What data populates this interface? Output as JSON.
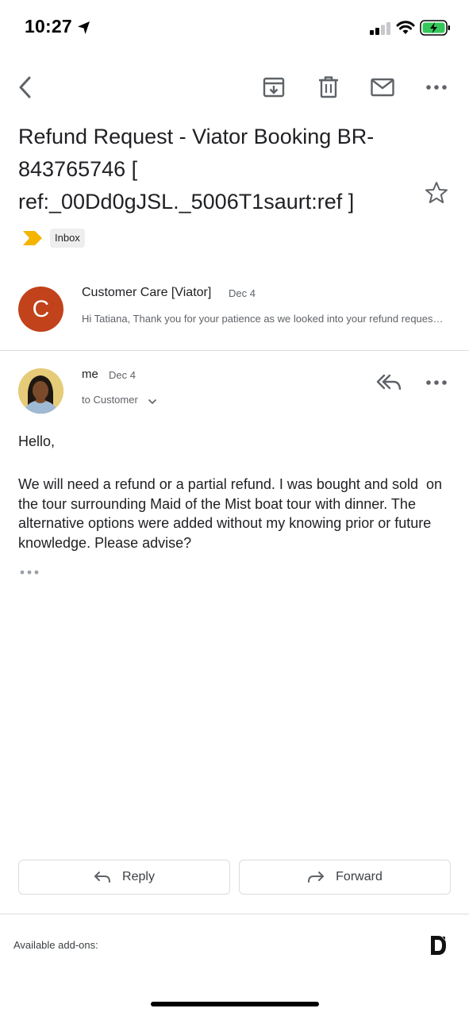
{
  "status_bar": {
    "time": "10:27",
    "battery_color": "#34c759"
  },
  "toolbar": {
    "icons": [
      "back-arrow-icon",
      "archive-icon",
      "trash-icon",
      "mail-icon",
      "more-icon"
    ]
  },
  "subject": {
    "text": "Refund Request - Viator Booking BR-843765746 [ ref:_00Dd0gJSL._5006T1saurt:ref ]",
    "label": "Inbox",
    "label_color": "#f4b400"
  },
  "thread": [
    {
      "avatar_letter": "C",
      "avatar_color": "#c1421b",
      "sender": "Customer Care [Viator]",
      "date": "Dec 4",
      "snippet": "Hi Tatiana, Thank you for your patience as we looked into your refund request. Unfortunately..."
    },
    {
      "sender": "me",
      "date": "Dec 4",
      "to": "to Customer",
      "greeting": "Hello,",
      "body": "We will need a refund or a partial refund. I was bought and sold  on the tour surrounding Maid of the Mist boat tour with dinner. The alternative options were added without my knowing prior or future knowledge. Please advise?"
    }
  ],
  "actions": {
    "reply": "Reply",
    "forward": "Forward"
  },
  "footer": {
    "addons": "Available add-ons:"
  }
}
